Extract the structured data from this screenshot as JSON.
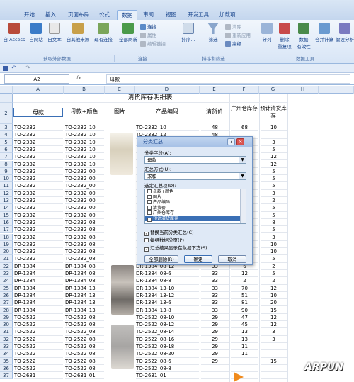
{
  "ribbon": {
    "tabs": [
      "开始",
      "插入",
      "页面布局",
      "公式",
      "数据",
      "审阅",
      "视图",
      "开发工具",
      "加载项"
    ],
    "active_tab": "数据",
    "buttons": {
      "access": "自 Access",
      "web": "自网站",
      "text": "自文本",
      "other": "自其他来源",
      "existing": "现有连接",
      "refresh": "全部刷新",
      "connections": "连接",
      "properties": "属性",
      "edit_links": "编辑链接",
      "sort": "排序...",
      "filter": "筛选",
      "clear": "清除",
      "reapply": "重新应用",
      "advanced": "高级",
      "split": "分列",
      "remove_dup": "删除\n重复项",
      "validation": "数据\n有效性",
      "consolidate": "合并计算",
      "whatif": "假设分析"
    },
    "groups": [
      "获取外部数据",
      "连接",
      "排序和筛选",
      "数据工具"
    ]
  },
  "formula_bar": {
    "name_box": "A2",
    "fx": "fx",
    "content": "母款"
  },
  "sheet": {
    "columns": [
      "A",
      "B",
      "C",
      "D",
      "E",
      "F",
      "G",
      "H",
      "I"
    ],
    "title": "清货库存明细表",
    "headers": [
      "母款",
      "母款+颜色",
      "图片",
      "产品编码",
      "清货价",
      "广州仓库存",
      "预计清货库存"
    ],
    "rows": [
      {
        "n": "3",
        "a": "TO-2332",
        "b": "TO-2332_10",
        "d": "TO-2332_10",
        "e": "48",
        "f": "68",
        "g": "10"
      },
      {
        "n": "4",
        "a": "TO-2332",
        "b": "TO-2332_10",
        "d": "TO-2332_12",
        "e": "48",
        "f": "",
        "g": ""
      },
      {
        "n": "5",
        "a": "TO-2332",
        "b": "TO-2332_10",
        "d": "",
        "e": "",
        "f": "",
        "g": "3"
      },
      {
        "n": "6",
        "a": "TO-2332",
        "b": "TO-2332_10",
        "d": "",
        "e": "",
        "f": "",
        "g": "5"
      },
      {
        "n": "7",
        "a": "TO-2332",
        "b": "TO-2332_10",
        "d": "",
        "e": "",
        "f": "",
        "g": "12"
      },
      {
        "n": "8",
        "a": "TO-2332",
        "b": "TO-2332_10",
        "d": "",
        "e": "",
        "f": "",
        "g": "12"
      },
      {
        "n": "9",
        "a": "TO-2332",
        "b": "TO-2332_00",
        "d": "",
        "e": "",
        "f": "",
        "g": "5"
      },
      {
        "n": "10",
        "a": "TO-2332",
        "b": "TO-2332_00",
        "d": "",
        "e": "",
        "f": "",
        "g": "5"
      },
      {
        "n": "11",
        "a": "TO-2332",
        "b": "TO-2332_00",
        "d": "",
        "e": "",
        "f": "",
        "g": "5"
      },
      {
        "n": "12",
        "a": "TO-2332",
        "b": "TO-2332_00",
        "d": "",
        "e": "",
        "f": "",
        "g": "3"
      },
      {
        "n": "13",
        "a": "TO-2332",
        "b": "TO-2332_00",
        "d": "",
        "e": "",
        "f": "",
        "g": "2"
      },
      {
        "n": "14",
        "a": "TO-2332",
        "b": "TO-2332_00",
        "d": "",
        "e": "",
        "f": "",
        "g": "5"
      },
      {
        "n": "15",
        "a": "TO-2332",
        "b": "TO-2332_00",
        "d": "",
        "e": "",
        "f": "",
        "g": "5"
      },
      {
        "n": "16",
        "a": "TO-2332",
        "b": "TO-2332_08",
        "d": "",
        "e": "",
        "f": "",
        "g": "8"
      },
      {
        "n": "17",
        "a": "TO-2332",
        "b": "TO-2332_08",
        "d": "",
        "e": "",
        "f": "",
        "g": "5"
      },
      {
        "n": "18",
        "a": "TO-2332",
        "b": "TO-2332_08",
        "d": "",
        "e": "",
        "f": "",
        "g": "3"
      },
      {
        "n": "19",
        "a": "TO-2332",
        "b": "TO-2332_08",
        "d": "",
        "e": "",
        "f": "",
        "g": "10"
      },
      {
        "n": "20",
        "a": "TO-2332",
        "b": "TO-2332_08",
        "d": "",
        "e": "",
        "f": "",
        "g": "10"
      },
      {
        "n": "21",
        "a": "TO-2332",
        "b": "TO-2332_08",
        "d": "",
        "e": "",
        "f": "",
        "g": "5"
      },
      {
        "n": "22",
        "a": "DR-1384",
        "b": "DR-1384_08",
        "d": "DR-1384_08-12",
        "e": "33",
        "f": "6",
        "g": "2"
      },
      {
        "n": "23",
        "a": "DR-1384",
        "b": "DR-1384_08",
        "d": "DR-1384_08-6",
        "e": "33",
        "f": "12",
        "g": "5"
      },
      {
        "n": "24",
        "a": "DR-1384",
        "b": "DR-1384_08",
        "d": "DR-1384_08-8",
        "e": "33",
        "f": "2",
        "g": "2"
      },
      {
        "n": "25",
        "a": "DR-1384",
        "b": "DR-1384_13",
        "d": "DR-1384_13-10",
        "e": "33",
        "f": "70",
        "g": "12"
      },
      {
        "n": "26",
        "a": "DR-1384",
        "b": "DR-1384_13",
        "d": "DR-1384_13-12",
        "e": "33",
        "f": "51",
        "g": "10"
      },
      {
        "n": "27",
        "a": "DR-1384",
        "b": "DR-1384_13",
        "d": "DR-1384_13-6",
        "e": "33",
        "f": "81",
        "g": "20"
      },
      {
        "n": "28",
        "a": "DR-1384",
        "b": "DR-1384_13",
        "d": "DR-1384_13-8",
        "e": "33",
        "f": "90",
        "g": "15"
      },
      {
        "n": "29",
        "a": "TO-2522",
        "b": "TO-2522_08",
        "d": "TO-2522_08-10",
        "e": "29",
        "f": "47",
        "g": "12"
      },
      {
        "n": "30",
        "a": "TO-2522",
        "b": "TO-2522_08",
        "d": "TO-2522_08-12",
        "e": "29",
        "f": "45",
        "g": "12"
      },
      {
        "n": "31",
        "a": "TO-2522",
        "b": "TO-2522_08",
        "d": "TO-2522_08-14",
        "e": "29",
        "f": "13",
        "g": "3"
      },
      {
        "n": "32",
        "a": "TO-2522",
        "b": "TO-2522_08",
        "d": "TO-2522_08-16",
        "e": "29",
        "f": "13",
        "g": "3"
      },
      {
        "n": "33",
        "a": "TO-2522",
        "b": "TO-2522_08",
        "d": "TO-2522_08-18",
        "e": "29",
        "f": "11",
        "g": ""
      },
      {
        "n": "34",
        "a": "TO-2522",
        "b": "TO-2522_08",
        "d": "TO-2522_08-20",
        "e": "29",
        "f": "11",
        "g": ""
      },
      {
        "n": "35",
        "a": "TO-2522",
        "b": "TO-2522_08",
        "d": "TO-2522_08-6",
        "e": "29",
        "f": "",
        "g": "15"
      },
      {
        "n": "36",
        "a": "TO-2522",
        "b": "TO-2522_08",
        "d": "TO-2522_08-8",
        "e": "",
        "f": "",
        "g": ""
      },
      {
        "n": "37",
        "a": "TO-2631",
        "b": "TO-2631_01",
        "d": "TO-2631_01",
        "e": "",
        "f": "",
        "g": ""
      }
    ]
  },
  "dialog": {
    "title": "分类汇总",
    "help": "?",
    "close": "×",
    "group_by_label": "分类字段(A):",
    "group_by_value": "母款",
    "func_label": "汇总方式(U):",
    "func_value": "求和",
    "fields_label": "选定汇总项(D):",
    "fields": [
      {
        "label": "母款+颜色",
        "checked": false
      },
      {
        "label": "图片",
        "checked": false
      },
      {
        "label": "产品编码",
        "checked": false
      },
      {
        "label": "清货价",
        "checked": false
      },
      {
        "label": "广州仓库存",
        "checked": false
      },
      {
        "label": "预计清货库存",
        "checked": true
      }
    ],
    "options": [
      {
        "label": "替换当前分类汇总(C)",
        "checked": true
      },
      {
        "label": "每组数据分页(P)",
        "checked": false
      },
      {
        "label": "汇总结果显示在数据下方(S)",
        "checked": true
      }
    ],
    "remove_all": "全部删除(R)",
    "ok": "确定",
    "cancel": "取消"
  },
  "watermark": "ARPUN"
}
